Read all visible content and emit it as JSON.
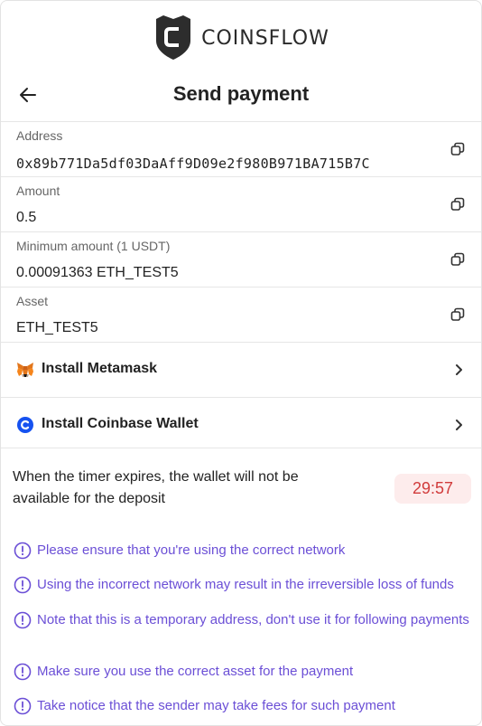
{
  "brand": {
    "name": "COINSFLOW"
  },
  "header": {
    "title": "Send payment"
  },
  "fields": [
    {
      "label": "Address",
      "value": "0x89b771Da5df03DaAff9D09e2f980B971BA715B7C"
    },
    {
      "label": "Amount",
      "value": "0.5"
    },
    {
      "label": "Minimum amount (1 USDT)",
      "value": "0.00091363 ETH_TEST5"
    },
    {
      "label": "Asset",
      "value": "ETH_TEST5"
    }
  ],
  "wallets": [
    {
      "label": "Install Metamask",
      "icon": "metamask-fox-icon"
    },
    {
      "label": "Install Coinbase Wallet",
      "icon": "coinbase-icon"
    }
  ],
  "timer": {
    "message": "When the timer expires, the wallet will not be available for the deposit",
    "value": "29:57"
  },
  "notices": [
    "Please ensure that you're using the correct network",
    "Using the incorrect network may result in the irreversible loss of funds",
    "Note that this is a temporary address, don't use it for following payments",
    "Make sure you use the correct asset for the payment",
    "Take notice that the sender may take fees for such payment"
  ],
  "colors": {
    "accent": "#6b4fd6",
    "timer_bg": "#fdecec",
    "timer_text": "#d13b3b",
    "coinbase_blue": "#1652f0"
  }
}
